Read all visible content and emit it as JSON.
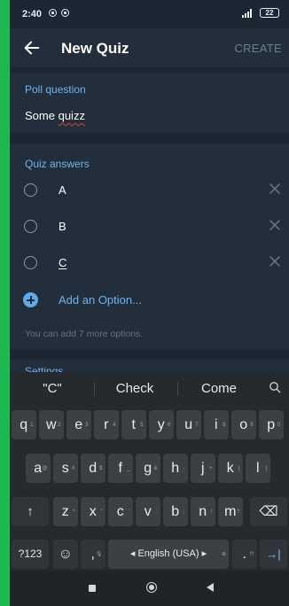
{
  "status_bar": {
    "time": "2:40",
    "battery": "22"
  },
  "app_bar": {
    "title": "New Quiz",
    "create_label": "CREATE"
  },
  "poll_question": {
    "header": "Poll question",
    "value": "Some quizz"
  },
  "quiz_answers": {
    "header": "Quiz answers",
    "options": [
      "A",
      "B",
      "C"
    ],
    "add_label": "Add an Option...",
    "hint": "You can add 7 more options."
  },
  "settings": {
    "header": "Settings"
  },
  "keyboard": {
    "suggestions": [
      "\"C\"",
      "Check",
      "Come"
    ],
    "row1": [
      {
        "k": "q",
        "a": "1"
      },
      {
        "k": "w",
        "a": "2"
      },
      {
        "k": "e",
        "a": "3"
      },
      {
        "k": "r",
        "a": "4"
      },
      {
        "k": "t",
        "a": "5"
      },
      {
        "k": "y",
        "a": "6"
      },
      {
        "k": "u",
        "a": "7"
      },
      {
        "k": "i",
        "a": "8"
      },
      {
        "k": "o",
        "a": "9"
      },
      {
        "k": "p",
        "a": "0"
      }
    ],
    "row2": [
      {
        "k": "a",
        "a": "@"
      },
      {
        "k": "s",
        "a": "#"
      },
      {
        "k": "d",
        "a": "$"
      },
      {
        "k": "f",
        "a": "_"
      },
      {
        "k": "g",
        "a": "&"
      },
      {
        "k": "h",
        "a": "-"
      },
      {
        "k": "j",
        "a": "+"
      },
      {
        "k": "k",
        "a": "("
      },
      {
        "k": "l",
        "a": ")"
      }
    ],
    "row3": [
      {
        "k": "z",
        "a": "*"
      },
      {
        "k": "x",
        "a": "\""
      },
      {
        "k": "c",
        "a": "'"
      },
      {
        "k": "v",
        "a": ":"
      },
      {
        "k": "b",
        "a": ";"
      },
      {
        "k": "n",
        "a": "!"
      },
      {
        "k": "m",
        "a": "?"
      }
    ],
    "shift": "↑",
    "backspace": "⌫",
    "symbols": "?123",
    "emoji": "☺",
    "comma": ",",
    "comma_alt": "🎙",
    "space": "◂ English (USA) ▸",
    "space_alt": "⊕",
    "period": ".",
    "period_alt": "!?",
    "enter": "→|"
  },
  "nav_bar": {
    "icons": [
      "recent-apps-icon",
      "home-icon",
      "back-icon"
    ]
  }
}
